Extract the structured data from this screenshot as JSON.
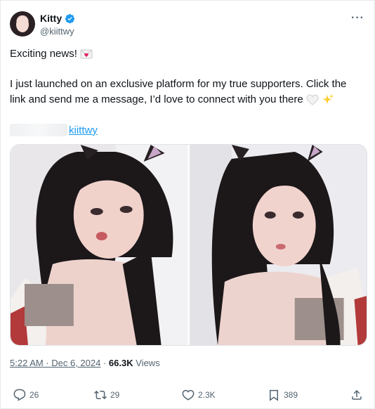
{
  "author": {
    "name": "Kitty",
    "handle": "@kiittwy"
  },
  "post": {
    "line1": "Exciting news!",
    "body": "I just launched on an exclusive platform for my true supporters. Click the link and send me a message, I’d love to connect with you there",
    "link_text": "kiittwy"
  },
  "meta": {
    "time": "5:22 AM · Dec 6, 2024",
    "separator": " · ",
    "views_count": "66.3K",
    "views_label": "Views"
  },
  "actions": {
    "replies": "26",
    "reposts": "29",
    "likes": "2.3K",
    "bookmarks": "389"
  },
  "icons": {
    "verified": "verified-badge-icon",
    "more": "more-dots-icon",
    "reply": "reply-icon",
    "repost": "repost-icon",
    "like": "heart-icon",
    "bookmark": "bookmark-icon",
    "share": "share-icon"
  },
  "colors": {
    "accent": "#1d9bf0",
    "muted": "#536471",
    "text": "#0f1419"
  }
}
